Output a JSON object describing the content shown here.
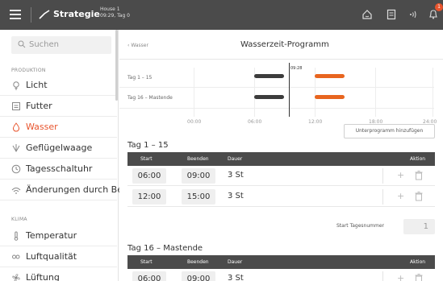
{
  "topbar": {
    "title": "Strategie",
    "house": "House 1",
    "date": "09:29, Tag 0",
    "notification_count": "1",
    "accent_color": "#e8542d"
  },
  "sidebar": {
    "search_placeholder": "Suchen",
    "section_production": "PRODUKTION",
    "section_climate": "KLIMA",
    "items": [
      {
        "label": "Licht",
        "icon": "bulb-icon"
      },
      {
        "label": "Futter",
        "icon": "feed-icon"
      },
      {
        "label": "Wasser",
        "icon": "water-drop-icon",
        "active": true
      },
      {
        "label": "Geflügelwaage",
        "icon": "scale-icon"
      },
      {
        "label": "Tagesschaltuhr",
        "icon": "clock-icon"
      },
      {
        "label": "Änderungen durch Be...",
        "icon": "wifi-icon"
      }
    ],
    "climate_items": [
      {
        "label": "Temperatur",
        "icon": "thermometer-icon"
      },
      {
        "label": "Luftqualität",
        "icon": "co2-icon"
      },
      {
        "label": "Lüftung",
        "icon": "fan-icon"
      }
    ]
  },
  "main": {
    "back_label": "Wasser",
    "page_title": "Wasserzeit-Programm",
    "timeline": {
      "rows": [
        "Tag 1 – 15",
        "Tag 16 – Mastende"
      ],
      "ticks": [
        "00:00",
        "06:00",
        "12:00",
        "18:00",
        "24:00"
      ],
      "now_label": "09:28"
    },
    "add_button": "Unterprogramm hinzufügen",
    "table1": {
      "title": "Tag 1 – 15",
      "headers": {
        "start": "Start",
        "end": "Beenden",
        "duration": "Dauer",
        "action": "Aktion"
      },
      "rows": [
        {
          "start": "06:00",
          "end": "09:00",
          "duration": "3 St"
        },
        {
          "start": "12:00",
          "end": "15:00",
          "duration": "3 St"
        }
      ]
    },
    "start_day_label": "Start Tagesnummer",
    "start_day_value": "1",
    "table2": {
      "title": "Tag 16 – Mastende",
      "headers": {
        "start": "Start",
        "end": "Beenden",
        "duration": "Dauer",
        "action": "Aktion"
      },
      "rows": [
        {
          "start": "06:00",
          "end": "09:00",
          "duration": "3 St"
        }
      ]
    }
  }
}
